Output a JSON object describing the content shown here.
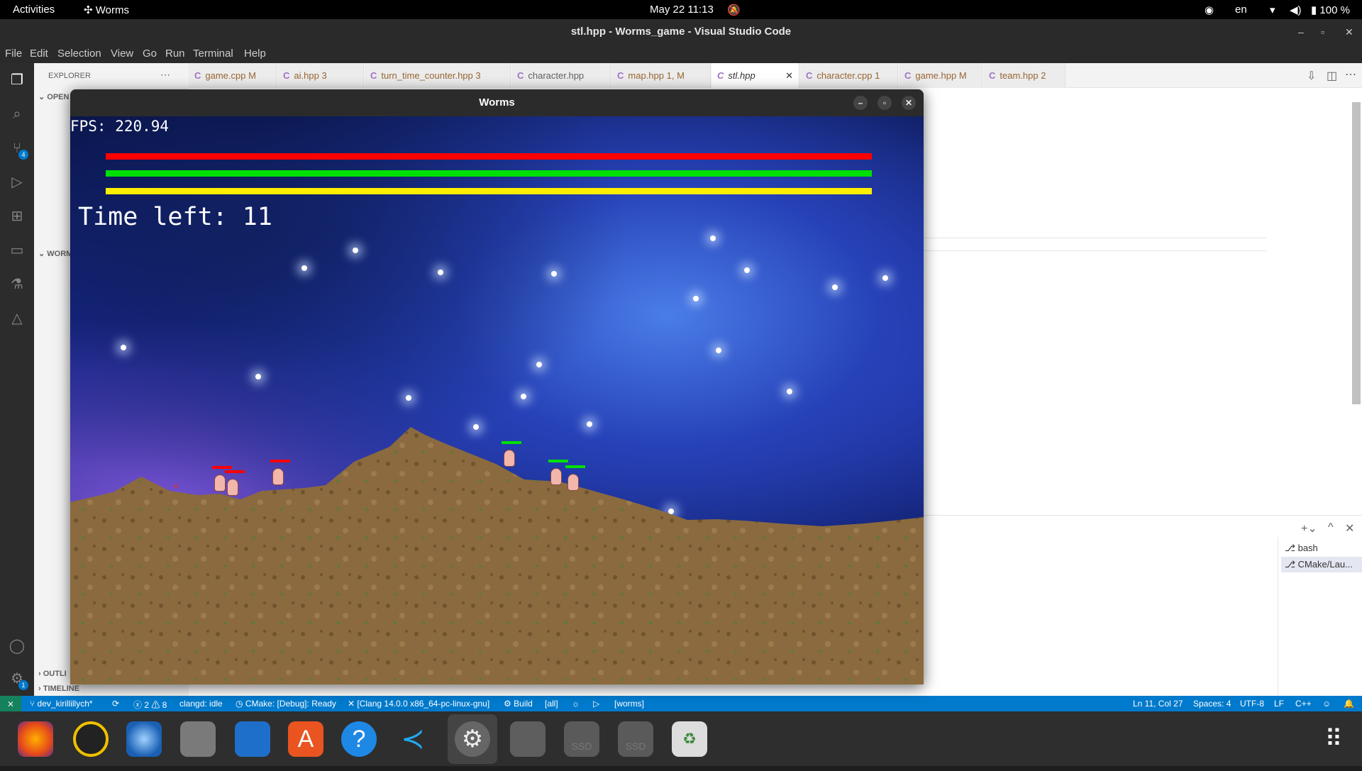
{
  "topbar": {
    "activities": "Activities",
    "app_name": "Worms",
    "datetime": "May 22  11:13",
    "lang": "en",
    "battery": "100 %"
  },
  "vscode": {
    "title": "stl.hpp - Worms_game - Visual Studio Code",
    "menu": [
      "File",
      "Edit",
      "Selection",
      "View",
      "Go",
      "Run",
      "Terminal",
      "Help"
    ],
    "sidebar": {
      "explorer_label": "EXPLORER",
      "open_editors": "OPEN",
      "workspace": "WORM",
      "outline": "OUTLI",
      "timeline": "TIMELINE"
    },
    "tabs": [
      {
        "name": "game.cpp",
        "badge": "M"
      },
      {
        "name": "ai.hpp",
        "badge": "3"
      },
      {
        "name": "turn_time_counter.hpp",
        "badge": "3"
      },
      {
        "name": "character.hpp",
        "badge": ""
      },
      {
        "name": "map.hpp",
        "badge": "1, M"
      },
      {
        "name": "stl.hpp",
        "badge": ""
      },
      {
        "name": "character.cpp",
        "badge": "1"
      },
      {
        "name": "game.hpp",
        "badge": "M"
      },
      {
        "name": "team.hpp",
        "badge": "2"
      }
    ],
    "terminal_list": [
      "bash",
      "CMake/Lau..."
    ],
    "statusbar": {
      "branch": "dev_kirillillych*",
      "problems": "ⓧ 2 ⚠ 8",
      "clangd": "clangd: idle",
      "cmake": "CMake: [Debug]: Ready",
      "kit": "[Clang 14.0.0 x86_64-pc-linux-gnu]",
      "build": "Build",
      "target": "[all]",
      "launch_target": "[worms]",
      "position": "Ln 11, Col 27",
      "spaces": "Spaces: 4",
      "encoding": "UTF-8",
      "eol": "LF",
      "language": "C++"
    },
    "source_control_badge": "4",
    "accounts_badge": "1"
  },
  "worms_window": {
    "title": "Worms",
    "fps_text": "FPS: 220.94",
    "time_left_text": "Time left: 11",
    "team_bars": [
      {
        "team": "red",
        "color": "#ff0000",
        "fraction": 1.0
      },
      {
        "team": "green",
        "color": "#00e000",
        "fraction": 1.0
      },
      {
        "team": "yellow",
        "color": "#ffee00",
        "fraction": 1.0
      }
    ],
    "worms": [
      {
        "team": "red",
        "hp_color": "#ff0000"
      },
      {
        "team": "red",
        "hp_color": "#ff0000"
      },
      {
        "team": "red",
        "hp_color": "#ff0000"
      },
      {
        "team": "green",
        "hp_color": "#00e000"
      },
      {
        "team": "green",
        "hp_color": "#00e000"
      },
      {
        "team": "green",
        "hp_color": "#00e000"
      }
    ]
  },
  "dock": [
    "firefox-icon",
    "rhythmbox-icon",
    "thunderbird-icon",
    "files-icon",
    "writer-icon",
    "app-center-icon",
    "help-icon",
    "vscode-icon",
    "settings-icon",
    "terminal-icon",
    "ssd-drive-icon",
    "ssd-drive-icon",
    "trash-icon",
    "show-apps-icon"
  ]
}
